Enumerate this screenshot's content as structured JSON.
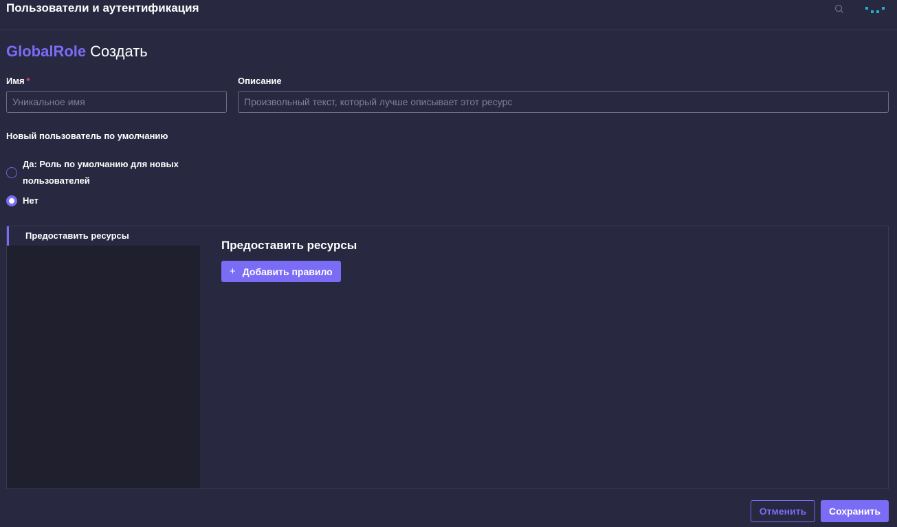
{
  "header": {
    "app_title": "Пользователи и аутентификация",
    "icons": [
      "search-icon",
      "brand-logo-icon"
    ]
  },
  "page": {
    "resource_type": "GlobalRole",
    "action": "Создать"
  },
  "form": {
    "name": {
      "label": "Имя",
      "required_mark": "*",
      "placeholder": "Уникальное имя",
      "value": ""
    },
    "description": {
      "label": "Описание",
      "placeholder": "Произвольный текст, который лучше описывает этот ресурс",
      "value": ""
    },
    "new_user_default": {
      "label": "Новый пользователь по умолчанию",
      "options": [
        {
          "label": "Да: Роль по умолчанию для новых пользователей",
          "checked": false
        },
        {
          "label": "Нет",
          "checked": true
        }
      ]
    }
  },
  "tabs": {
    "items": [
      {
        "label": "Предоставить ресурсы",
        "active": true
      }
    ],
    "content": {
      "title": "Предоставить ресурсы",
      "add_rule_label": "Добавить правило"
    }
  },
  "footer": {
    "cancel_label": "Отменить",
    "save_label": "Сохранить"
  },
  "colors": {
    "background": "#282840",
    "accent": "#7b6cf6",
    "required": "#e0457b",
    "brand": "#1fb5c8"
  }
}
